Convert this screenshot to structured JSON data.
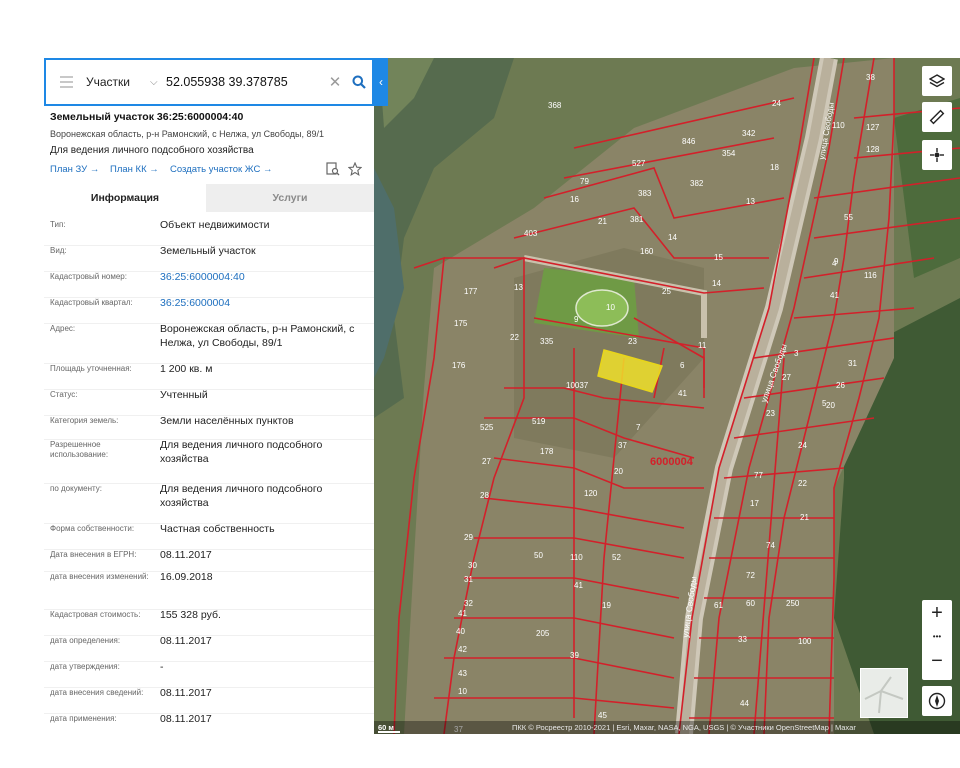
{
  "search": {
    "layer_select": "Участки",
    "query": "52.055938 39.378785"
  },
  "parcel": {
    "title": "Земельный участок 36:25:6000004:40",
    "address_line": "Воронежская область, р-н Рамонский, с Нелжа, ул Свободы, 89/1",
    "usage": "Для ведения личного подсобного хозяйства",
    "links": [
      "План ЗУ →",
      "План КК →",
      "Создать участок ЖС →"
    ]
  },
  "tabs": {
    "info": "Информация",
    "services": "Услуги"
  },
  "fields": [
    {
      "label": "Тип:",
      "value": "Объект недвижимости"
    },
    {
      "label": "Вид:",
      "value": "Земельный участок"
    },
    {
      "label": "Кадастровый номер:",
      "value": "36:25:6000004:40"
    },
    {
      "label": "Кадастровый квартал:",
      "value": "36:25:6000004"
    },
    {
      "label": "Адрес:",
      "value": "Воронежская область, р-н Рамонский, с Нелжа, ул Свободы, 89/1"
    },
    {
      "label": "Площадь уточненная:",
      "value": "1 200 кв. м"
    },
    {
      "label": "Статус:",
      "value": "Учтенный"
    },
    {
      "label": "Категория земель:",
      "value": "Земли населённых пунктов"
    },
    {
      "label": "Разрешенное использование:",
      "value": "Для ведения личного подсобного хозяйства"
    },
    {
      "label": "по документу:",
      "value": "Для ведения личного подсобного хозяйства"
    },
    {
      "label": "Форма собственности:",
      "value": "Частная собственность"
    },
    {
      "label": "Дата внесения в ЕГРН:",
      "value": "08.11.2017"
    },
    {
      "label": "дата внесения изменений:",
      "value": "16.09.2018"
    },
    {
      "label": "Кадастровая стоимость:",
      "value": "155 328 руб."
    },
    {
      "label": "дата определения:",
      "value": "08.11.2017"
    },
    {
      "label": "дата утверждения:",
      "value": "-"
    },
    {
      "label": "дата внесения сведений:",
      "value": "08.11.2017"
    },
    {
      "label": "дата применения:",
      "value": "08.11.2017"
    }
  ],
  "map": {
    "parcel_numbers": [
      "38",
      "24",
      "127",
      "342",
      "110",
      "128",
      "368",
      "846",
      "354",
      "18",
      "527",
      "79",
      "383",
      "382",
      "13",
      "16",
      "403",
      "21",
      "381",
      "14",
      "55",
      "9",
      "160",
      "15",
      "116",
      "4",
      "177",
      "13",
      "25",
      "14",
      "41",
      "10",
      "9",
      "175",
      "22",
      "335",
      "23",
      "11",
      "3",
      "31",
      "176",
      "10037",
      "6",
      "27",
      "26",
      "5",
      "41",
      "20",
      "23",
      "525",
      "519",
      "7",
      "24",
      "178",
      "37",
      "6000004",
      "27",
      "20",
      "22",
      "77",
      "28",
      "120",
      "17",
      "21",
      "29",
      "50",
      "110",
      "52",
      "74",
      "30",
      "72",
      "31",
      "41",
      "32",
      "19",
      "61",
      "60",
      "250",
      "41",
      "205",
      "33",
      "40",
      "39",
      "100",
      "42",
      "43",
      "44",
      "10",
      "45",
      "37",
      "35"
    ],
    "quarter_label": "6000004",
    "street_labels": [
      "улица Свободы",
      "улица Свободы",
      "улица Свободы"
    ],
    "highlight_color": "#f0e02a",
    "boundary_color": "#d3202a"
  },
  "map_controls": {
    "zoom_in": "+",
    "zoom_more": "•••",
    "zoom_out": "−"
  },
  "attribution": {
    "scale": "60 м",
    "text": "ПКК © Росреестр 2010-2021 | Esri, Maxar, NASA, NGA, USGS | © Участники OpenStreetMap | Maxar"
  }
}
